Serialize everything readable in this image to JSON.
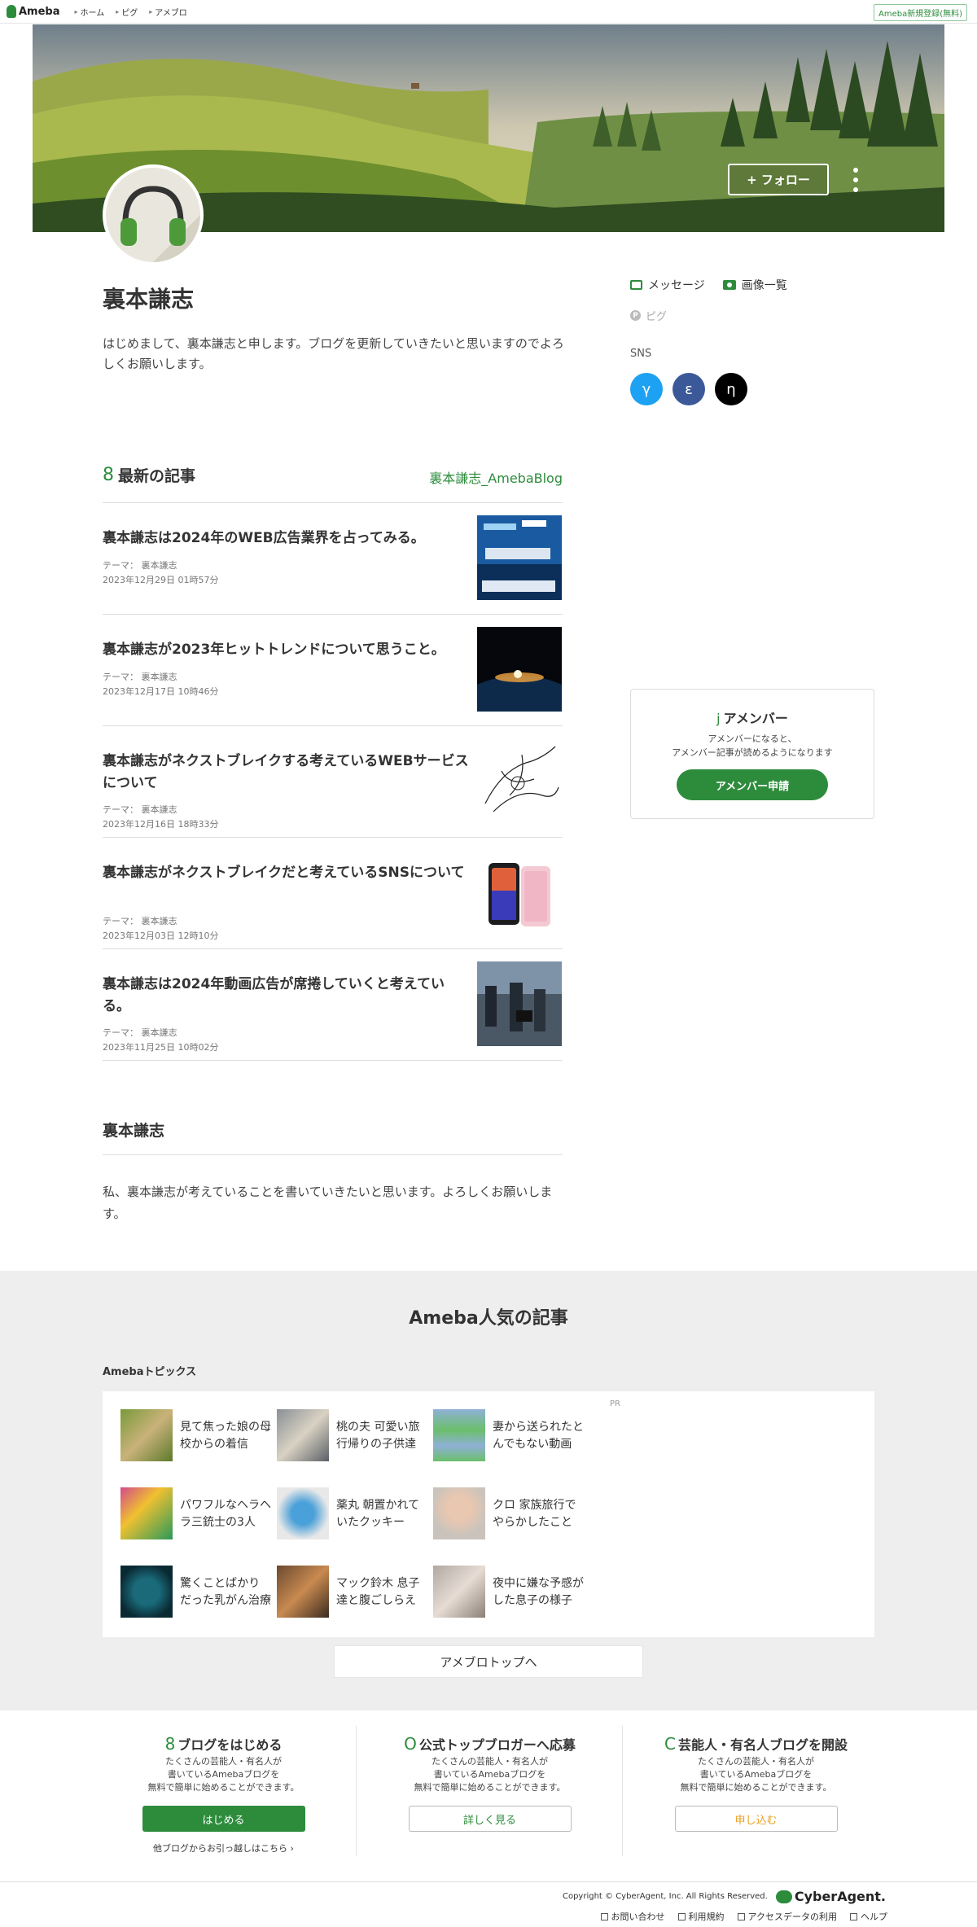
{
  "header": {
    "logo": "Ameba",
    "breadcrumbs": [
      "ホーム",
      "ピグ",
      "アメブロ"
    ],
    "signup": "Ameba新規登録(無料)"
  },
  "profile": {
    "follow": "+ フォロー",
    "name": "裏本謙志",
    "intro": "はじめまして、裏本謙志と申します。ブログを更新していきたいと思いますのでよろしくお願いします。",
    "message": "メッセージ",
    "images": "画像一覧",
    "pig": "ピグ",
    "sns_label": "SNS",
    "sns": [
      {
        "glyph": "γ",
        "color": "#1da1f2"
      },
      {
        "glyph": "ε",
        "color": "#3b5998"
      },
      {
        "glyph": "η",
        "color": "#000000"
      }
    ]
  },
  "latest": {
    "icon": "8",
    "title": "最新の記事",
    "blog_link": "裏本謙志_AmebaBlog",
    "articles": [
      {
        "title": "裏本謙志は2024年のWEB広告業界を占ってみる。",
        "theme": "テーマ： 裏本謙志",
        "date": "2023年12月29日 01時57分"
      },
      {
        "title": "裏本謙志が2023年ヒットトレンドについて思うこと。",
        "theme": "テーマ： 裏本謙志",
        "date": "2023年12月17日 10時46分"
      },
      {
        "title": "裏本謙志がネクストブレイクする考えているWEBサービスについて",
        "theme": "テーマ： 裏本謙志",
        "date": "2023年12月16日 18時33分"
      },
      {
        "title": "裏本謙志がネクストブレイクだと考えているSNSについて",
        "theme": "テーマ： 裏本謙志",
        "date": "2023年12月03日 12時10分"
      },
      {
        "title": "裏本謙志は2024年動画広告が席捲していくと考えている。",
        "theme": "テーマ： 裏本謙志",
        "date": "2023年11月25日 10時02分"
      }
    ]
  },
  "about": {
    "title": "裏本謙志",
    "body": "私、裏本謙志が考えていることを書いていきたいと思います。よろしくお願いします。"
  },
  "member": {
    "icon": "j",
    "title": "アメンバー",
    "desc1": "アメンバーになると、",
    "desc2": "アメンバー記事が読めるようになります",
    "button": "アメンバー申請"
  },
  "popular": {
    "title": "Ameba人気の記事",
    "subtitle": "Amebaトピックス",
    "pr": "PR",
    "topics": [
      {
        "l1": "見て焦った娘の母",
        "l2": "校からの着信"
      },
      {
        "l1": "桃の夫 可愛い旅",
        "l2": "行帰りの子供達"
      },
      {
        "l1": "妻から送られたと",
        "l2": "んでもない動画"
      },
      {
        "l1": "パワフルなヘラヘ",
        "l2": "ラ三銃士の3人"
      },
      {
        "l1": "薬丸 朝置かれて",
        "l2": "いたクッキー"
      },
      {
        "l1": "クロ 家族旅行で",
        "l2": "やらかしたこと"
      },
      {
        "l1": "驚くことばかり",
        "l2": "だった乳がん治療"
      },
      {
        "l1": "マック鈴木 息子",
        "l2": "達と腹ごしらえ"
      },
      {
        "l1": "夜中に嫌な予感が",
        "l2": "した息子の様子"
      }
    ],
    "to_top": "アメブロトップへ"
  },
  "promo": [
    {
      "icon": "8",
      "title": "ブログをはじめる",
      "d1": "たくさんの芸能人・有名人が",
      "d2": "書いているAmebaブログを",
      "d3": "無料で簡単に始めることができます。",
      "button": "はじめる",
      "sub": "他ブログからお引っ越しはこちら ›",
      "btn_bg": "#2d8c3c",
      "btn_fg": "#ffffff"
    },
    {
      "icon": "O",
      "title": "公式トップブロガーへ応募",
      "d1": "たくさんの芸能人・有名人が",
      "d2": "書いているAmebaブログを",
      "d3": "無料で簡単に始めることができます。",
      "button": "詳しく見る",
      "sub": "",
      "btn_bg": "#ffffff",
      "btn_fg": "#2d8c3c"
    },
    {
      "icon": "C",
      "title": "芸能人・有名人ブログを開設",
      "d1": "たくさんの芸能人・有名人が",
      "d2": "書いているAmebaブログを",
      "d3": "無料で簡単に始めることができます。",
      "button": "申し込む",
      "sub": "",
      "btn_bg": "#ffffff",
      "btn_fg": "#e8a020"
    }
  ],
  "footer": {
    "copyright": "Copyright © CyberAgent, Inc. All Rights Reserved.",
    "company": "CyberAgent.",
    "links": [
      "お問い合わせ",
      "利用規約",
      "アクセスデータの利用",
      "ヘルプ"
    ]
  }
}
